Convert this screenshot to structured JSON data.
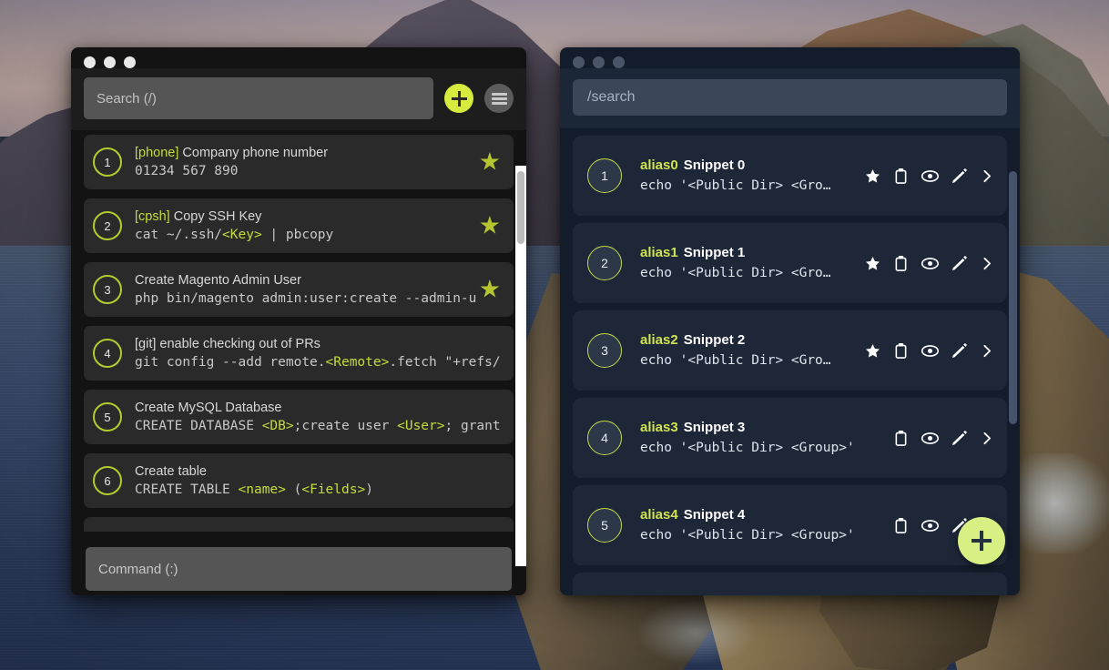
{
  "desktop": {
    "wallpaper_description": "coastal cliffs and ocean at dusk"
  },
  "left_window": {
    "traffic_lights": [
      "close",
      "minimize",
      "maximize"
    ],
    "search": {
      "placeholder": "Search (/)",
      "value": ""
    },
    "add_button_label": "+",
    "menu_button_label": "menu",
    "command": {
      "placeholder": "Command (:)",
      "value": ""
    },
    "items": [
      {
        "num": "1",
        "alias": "[phone]",
        "title": "Company phone number",
        "cmd_parts": [
          {
            "t": "01234 567 890",
            "var": false
          }
        ],
        "starred": true
      },
      {
        "num": "2",
        "alias": "[cpsh]",
        "title": "Copy SSH Key",
        "cmd_parts": [
          {
            "t": "cat ~/.ssh/",
            "var": false
          },
          {
            "t": "<Key>",
            "var": true
          },
          {
            "t": " | pbcopy",
            "var": false
          }
        ],
        "starred": true
      },
      {
        "num": "3",
        "alias": "",
        "title": "Create Magento Admin User",
        "cmd_parts": [
          {
            "t": "php bin/magento admin:user:create --admin-u",
            "var": false
          }
        ],
        "starred": true
      },
      {
        "num": "4",
        "alias": "",
        "title": "[git] enable checking out of PRs",
        "cmd_parts": [
          {
            "t": "git config --add remote.",
            "var": false
          },
          {
            "t": "<Remote>",
            "var": true
          },
          {
            "t": ".fetch \"+refs/",
            "var": false
          }
        ],
        "starred": false
      },
      {
        "num": "5",
        "alias": "",
        "title": "Create MySQL Database",
        "cmd_parts": [
          {
            "t": "CREATE DATABASE ",
            "var": false
          },
          {
            "t": "<DB>",
            "var": true
          },
          {
            "t": ";create user ",
            "var": false
          },
          {
            "t": "<User>",
            "var": true
          },
          {
            "t": "; grant",
            "var": false
          }
        ],
        "starred": false
      },
      {
        "num": "6",
        "alias": "",
        "title": "Create table",
        "cmd_parts": [
          {
            "t": "CREATE TABLE ",
            "var": false
          },
          {
            "t": "<name>",
            "var": true
          },
          {
            "t": " (",
            "var": false
          },
          {
            "t": "<Fields>",
            "var": true
          },
          {
            "t": ")",
            "var": false
          }
        ],
        "starred": false
      }
    ]
  },
  "right_window": {
    "traffic_lights": [
      "close",
      "minimize",
      "maximize"
    ],
    "search": {
      "placeholder": "/search",
      "value": ""
    },
    "fab_label": "+",
    "icons": [
      "star-icon",
      "clipboard-icon",
      "eye-icon",
      "pencil-icon",
      "chevron-right-icon"
    ],
    "items": [
      {
        "num": "1",
        "alias": "alias0",
        "name": "Snippet 0",
        "cmd": "echo '<Public Dir> <Gro…",
        "starred": true
      },
      {
        "num": "2",
        "alias": "alias1",
        "name": "Snippet 1",
        "cmd": "echo '<Public Dir> <Gro…",
        "starred": true
      },
      {
        "num": "3",
        "alias": "alias2",
        "name": "Snippet 2",
        "cmd": "echo '<Public Dir> <Gro…",
        "starred": true
      },
      {
        "num": "4",
        "alias": "alias3",
        "name": "Snippet 3",
        "cmd": "echo '<Public Dir> <Group>'",
        "starred": false
      },
      {
        "num": "5",
        "alias": "alias4",
        "name": "Snippet 4",
        "cmd": "echo '<Public Dir> <Group>'",
        "starred": false
      }
    ]
  },
  "colors": {
    "accent_green": "#c5dc3a",
    "fab_green": "#d8ef84",
    "left_window_bg": "#131313",
    "left_row_bg": "#2a2a2a",
    "right_window_bg": "#131c2b",
    "right_row_bg": "#1d2738",
    "star_olive": "#b4c52f"
  }
}
